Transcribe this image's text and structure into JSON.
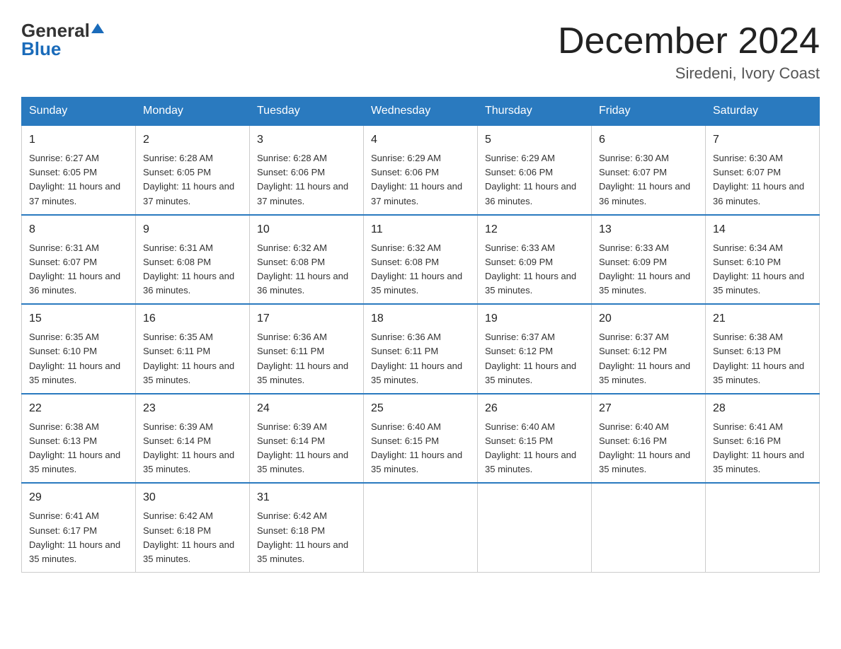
{
  "header": {
    "logo_general": "General",
    "logo_blue": "Blue",
    "month_title": "December 2024",
    "location": "Siredeni, Ivory Coast"
  },
  "weekdays": [
    "Sunday",
    "Monday",
    "Tuesday",
    "Wednesday",
    "Thursday",
    "Friday",
    "Saturday"
  ],
  "weeks": [
    [
      {
        "day": "1",
        "sunrise": "6:27 AM",
        "sunset": "6:05 PM",
        "daylight": "11 hours and 37 minutes."
      },
      {
        "day": "2",
        "sunrise": "6:28 AM",
        "sunset": "6:05 PM",
        "daylight": "11 hours and 37 minutes."
      },
      {
        "day": "3",
        "sunrise": "6:28 AM",
        "sunset": "6:06 PM",
        "daylight": "11 hours and 37 minutes."
      },
      {
        "day": "4",
        "sunrise": "6:29 AM",
        "sunset": "6:06 PM",
        "daylight": "11 hours and 37 minutes."
      },
      {
        "day": "5",
        "sunrise": "6:29 AM",
        "sunset": "6:06 PM",
        "daylight": "11 hours and 36 minutes."
      },
      {
        "day": "6",
        "sunrise": "6:30 AM",
        "sunset": "6:07 PM",
        "daylight": "11 hours and 36 minutes."
      },
      {
        "day": "7",
        "sunrise": "6:30 AM",
        "sunset": "6:07 PM",
        "daylight": "11 hours and 36 minutes."
      }
    ],
    [
      {
        "day": "8",
        "sunrise": "6:31 AM",
        "sunset": "6:07 PM",
        "daylight": "11 hours and 36 minutes."
      },
      {
        "day": "9",
        "sunrise": "6:31 AM",
        "sunset": "6:08 PM",
        "daylight": "11 hours and 36 minutes."
      },
      {
        "day": "10",
        "sunrise": "6:32 AM",
        "sunset": "6:08 PM",
        "daylight": "11 hours and 36 minutes."
      },
      {
        "day": "11",
        "sunrise": "6:32 AM",
        "sunset": "6:08 PM",
        "daylight": "11 hours and 35 minutes."
      },
      {
        "day": "12",
        "sunrise": "6:33 AM",
        "sunset": "6:09 PM",
        "daylight": "11 hours and 35 minutes."
      },
      {
        "day": "13",
        "sunrise": "6:33 AM",
        "sunset": "6:09 PM",
        "daylight": "11 hours and 35 minutes."
      },
      {
        "day": "14",
        "sunrise": "6:34 AM",
        "sunset": "6:10 PM",
        "daylight": "11 hours and 35 minutes."
      }
    ],
    [
      {
        "day": "15",
        "sunrise": "6:35 AM",
        "sunset": "6:10 PM",
        "daylight": "11 hours and 35 minutes."
      },
      {
        "day": "16",
        "sunrise": "6:35 AM",
        "sunset": "6:11 PM",
        "daylight": "11 hours and 35 minutes."
      },
      {
        "day": "17",
        "sunrise": "6:36 AM",
        "sunset": "6:11 PM",
        "daylight": "11 hours and 35 minutes."
      },
      {
        "day": "18",
        "sunrise": "6:36 AM",
        "sunset": "6:11 PM",
        "daylight": "11 hours and 35 minutes."
      },
      {
        "day": "19",
        "sunrise": "6:37 AM",
        "sunset": "6:12 PM",
        "daylight": "11 hours and 35 minutes."
      },
      {
        "day": "20",
        "sunrise": "6:37 AM",
        "sunset": "6:12 PM",
        "daylight": "11 hours and 35 minutes."
      },
      {
        "day": "21",
        "sunrise": "6:38 AM",
        "sunset": "6:13 PM",
        "daylight": "11 hours and 35 minutes."
      }
    ],
    [
      {
        "day": "22",
        "sunrise": "6:38 AM",
        "sunset": "6:13 PM",
        "daylight": "11 hours and 35 minutes."
      },
      {
        "day": "23",
        "sunrise": "6:39 AM",
        "sunset": "6:14 PM",
        "daylight": "11 hours and 35 minutes."
      },
      {
        "day": "24",
        "sunrise": "6:39 AM",
        "sunset": "6:14 PM",
        "daylight": "11 hours and 35 minutes."
      },
      {
        "day": "25",
        "sunrise": "6:40 AM",
        "sunset": "6:15 PM",
        "daylight": "11 hours and 35 minutes."
      },
      {
        "day": "26",
        "sunrise": "6:40 AM",
        "sunset": "6:15 PM",
        "daylight": "11 hours and 35 minutes."
      },
      {
        "day": "27",
        "sunrise": "6:40 AM",
        "sunset": "6:16 PM",
        "daylight": "11 hours and 35 minutes."
      },
      {
        "day": "28",
        "sunrise": "6:41 AM",
        "sunset": "6:16 PM",
        "daylight": "11 hours and 35 minutes."
      }
    ],
    [
      {
        "day": "29",
        "sunrise": "6:41 AM",
        "sunset": "6:17 PM",
        "daylight": "11 hours and 35 minutes."
      },
      {
        "day": "30",
        "sunrise": "6:42 AM",
        "sunset": "6:18 PM",
        "daylight": "11 hours and 35 minutes."
      },
      {
        "day": "31",
        "sunrise": "6:42 AM",
        "sunset": "6:18 PM",
        "daylight": "11 hours and 35 minutes."
      },
      null,
      null,
      null,
      null
    ]
  ]
}
